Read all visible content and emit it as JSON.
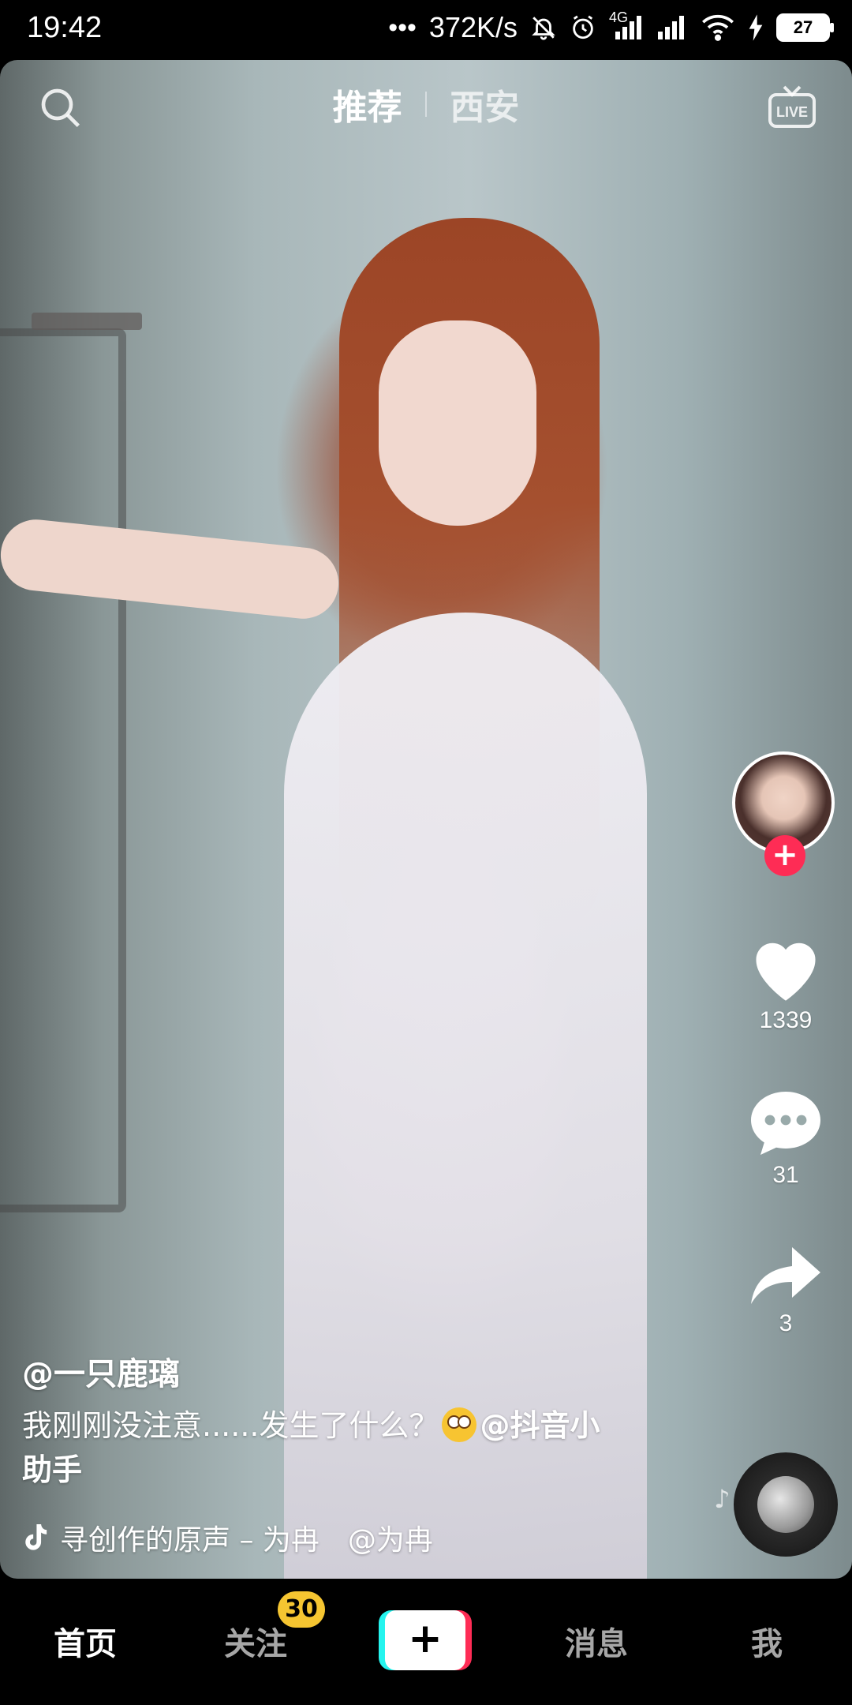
{
  "status_bar": {
    "time": "19:42",
    "speed": "372K/s",
    "network": "4G",
    "battery": "27"
  },
  "top_bar": {
    "tabs": [
      {
        "label": "推荐",
        "active": true
      },
      {
        "label": "西安",
        "active": false
      }
    ],
    "live_label": "LIVE"
  },
  "right_rail": {
    "like_count": "1339",
    "comment_count": "31",
    "share_count": "3",
    "follow_symbol": "+"
  },
  "caption": {
    "author": "@一只鹿璃",
    "text_part1": "我刚刚没注意......发生了什么？",
    "mention": "@抖音小",
    "text_part2": "助手"
  },
  "music": {
    "title": "寻创作的原声 – 为冉",
    "mention": "@为冉"
  },
  "bottom_nav": {
    "items": [
      {
        "label": "首页",
        "active": true
      },
      {
        "label": "关注",
        "active": false,
        "badge": "30"
      },
      {
        "label": "+",
        "active": false
      },
      {
        "label": "消息",
        "active": false
      },
      {
        "label": "我",
        "active": false
      }
    ]
  },
  "colors": {
    "accent_red": "#fe2c55",
    "accent_cyan": "#25f4ee",
    "badge_yellow": "#f5c531"
  }
}
